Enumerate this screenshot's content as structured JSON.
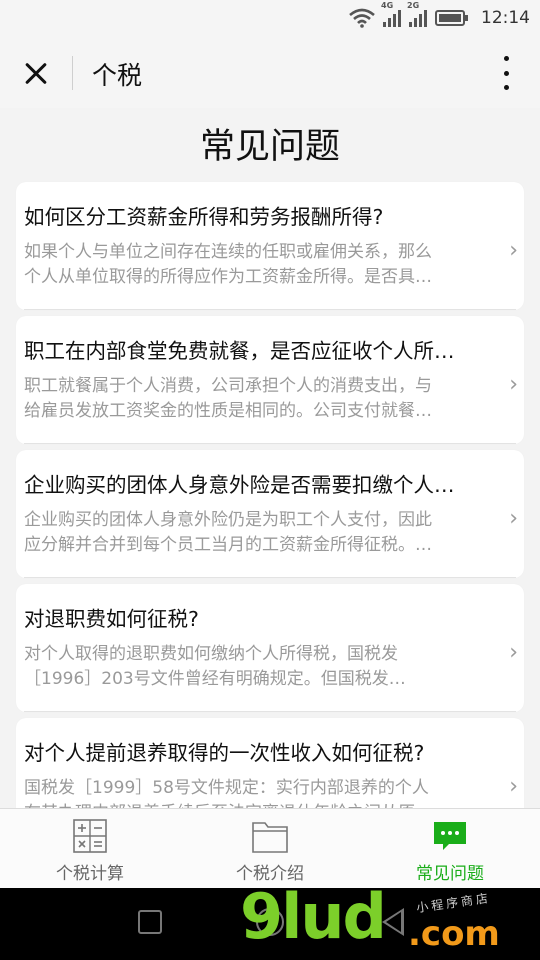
{
  "status_bar": {
    "time": "12:14",
    "signal1_label": "4G",
    "signal2_label": "2G",
    "icons": [
      "wifi-icon",
      "signal-4g-icon",
      "signal-2g-icon",
      "battery-icon"
    ]
  },
  "header": {
    "title": "个税",
    "close_icon": "close-icon",
    "more_icon": "more-vertical-icon"
  },
  "page": {
    "title": "常见问题"
  },
  "faq": {
    "items": [
      {
        "question": "如何区分工资薪金所得和劳务报酬所得?",
        "answer_line1": "如果个人与单位之间存在连续的任职或雇佣关系，那么",
        "answer_line2": "个人从单位取得的所得应作为工资薪金所得。是否具…"
      },
      {
        "question": "职工在内部食堂免费就餐，是否应征收个人所…",
        "answer_line1": "职工就餐属于个人消费，公司承担个人的消费支出，与",
        "answer_line2": "给雇员发放工资奖金的性质是相同的。公司支付就餐…"
      },
      {
        "question": "企业购买的团体人身意外险是否需要扣缴个人…",
        "answer_line1": "企业购买的团体人身意外险仍是为职工个人支付，因此",
        "answer_line2": "应分解并合并到每个员工当月的工资薪金所得征税。…"
      },
      {
        "question": "对退职费如何征税?",
        "answer_line1": "对个人取得的退职费如何缴纳个人所得税，国税发",
        "answer_line2": "［1996］203号文件曾经有明确规定。但国税发…"
      },
      {
        "question": "对个人提前退养取得的一次性收入如何征税?",
        "answer_line1": "国税发［1999］58号文件规定：实行内部退养的个人",
        "answer_line2": "在其办理内部退养手续后至法定离退休年龄之间从原…"
      }
    ],
    "chevron": "›"
  },
  "tab_bar": {
    "tabs": [
      {
        "label": "个税计算",
        "icon": "calculator-icon",
        "active": false
      },
      {
        "label": "个税介绍",
        "icon": "folder-icon",
        "active": false
      },
      {
        "label": "常见问题",
        "icon": "chat-bubble-icon",
        "active": true
      }
    ],
    "active_color": "#1aad19",
    "inactive_color": "#666666"
  },
  "watermark": {
    "main": "9lud",
    "suffix": ".com",
    "small": "小程序商店"
  }
}
